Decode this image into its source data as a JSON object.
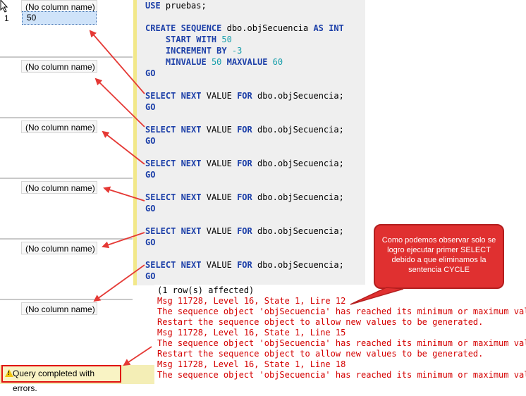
{
  "results": {
    "header_label": "(No column name)",
    "row_number": "1",
    "first_value": "50"
  },
  "editor": {
    "use_kw": "USE",
    "use_db": "pruebas;",
    "create_kw": "CREATE SEQUENCE",
    "seq_name": "dbo.objSecuencia",
    "as_int": "AS INT",
    "start_kw": "START WITH",
    "start_val": "50",
    "incr_kw": "INCREMENT BY",
    "incr_val": "-3",
    "minv_kw": "MINVALUE",
    "minv_val": "50",
    "maxv_kw": "MAXVALUE",
    "maxv_val": "60",
    "go": "GO",
    "select_kw": "SELECT NEXT",
    "value_kw": "VALUE",
    "for_kw": "FOR",
    "select_target": "dbo.objSecuencia;"
  },
  "output": {
    "lines": [
      {
        "text": "(1 row(s) affected)",
        "red": false
      },
      {
        "text": "Msg 11728, Level 16, State 1, Lire 12",
        "red": true
      },
      {
        "text": "The sequence object 'objSecuencia' has reached its minimum or maximum value",
        "red": true
      },
      {
        "text": "Restart the sequence object to allow new values to be generated.",
        "red": true
      },
      {
        "text": "Msg 11728, Level 16, State 1, Line 15",
        "red": true
      },
      {
        "text": "The sequence object 'objSecuencia' has reached its minimum or maximum value",
        "red": true
      },
      {
        "text": "Restart the sequence object to allow new values to be generated.",
        "red": true
      },
      {
        "text": "Msg 11728, Level 16, State 1, Line 18",
        "red": true
      },
      {
        "text": "The sequence object 'objSecuencia' has reached its minimum or maximum value",
        "red": true
      }
    ]
  },
  "callout": {
    "text": "Como podemos observar solo se logro ejecutar primer SELECT debido a que eliminamos la sentencia CYCLE"
  },
  "status": {
    "text": "Query completed with errors.",
    "icon": "warning-icon"
  },
  "colors": {
    "keyword": "#1c3fa8",
    "number": "#179eab",
    "error": "#d40000",
    "arrow": "#e53935",
    "callout": "#e03030",
    "status_bg": "#f4eeb6"
  }
}
